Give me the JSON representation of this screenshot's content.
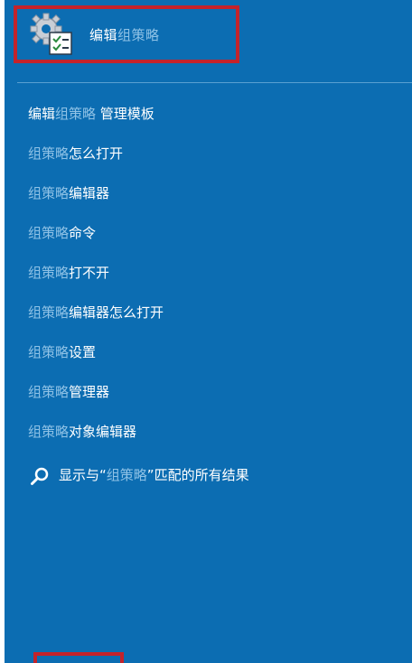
{
  "top_result": {
    "prefix": "编辑",
    "query": "组策略",
    "icon": "group-policy-gear-checklist-icon"
  },
  "results": [
    {
      "pre": "编辑",
      "hl": "组策略",
      "post": " 管理模板"
    },
    {
      "pre": "",
      "hl": "组策略",
      "post": "怎么打开"
    },
    {
      "pre": "",
      "hl": "组策略",
      "post": "编辑器"
    },
    {
      "pre": "",
      "hl": "组策略",
      "post": "命令"
    },
    {
      "pre": "",
      "hl": "组策略",
      "post": "打不开"
    },
    {
      "pre": "",
      "hl": "组策略",
      "post": "编辑器怎么打开"
    },
    {
      "pre": "",
      "hl": "组策略",
      "post": "设置"
    },
    {
      "pre": "",
      "hl": "组策略",
      "post": "管理器"
    },
    {
      "pre": "",
      "hl": "组策略",
      "post": "对象编辑器"
    }
  ],
  "web_search": {
    "pre": "显示与“",
    "hl": "组策略",
    "post": "”匹配的所有结果",
    "icon": "search-icon"
  },
  "colors": {
    "panel_bg": "#0c6db2",
    "highlight_text": "#8fc2e6",
    "selection_border": "#c4232b"
  }
}
